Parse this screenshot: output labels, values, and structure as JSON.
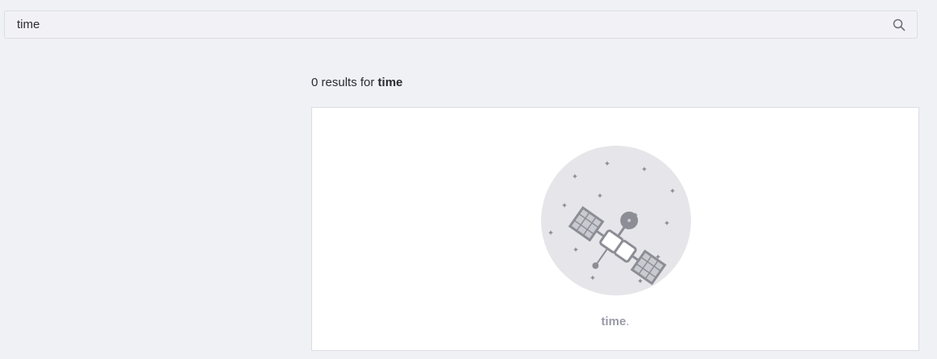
{
  "search": {
    "value": "time",
    "placeholder": "",
    "icon": "search-icon"
  },
  "results": {
    "count_text": "0 results for ",
    "query": "time"
  },
  "empty_state": {
    "illustration": "satellite-in-space-illustration",
    "caption_query": "time",
    "caption_suffix": "."
  },
  "colors": {
    "page_background": "#f0f1f5",
    "card_background": "#ffffff",
    "illustration_circle": "#e6e6ea",
    "illustration_stroke": "#8d8d96",
    "caption_text": "#9a9aa8"
  }
}
